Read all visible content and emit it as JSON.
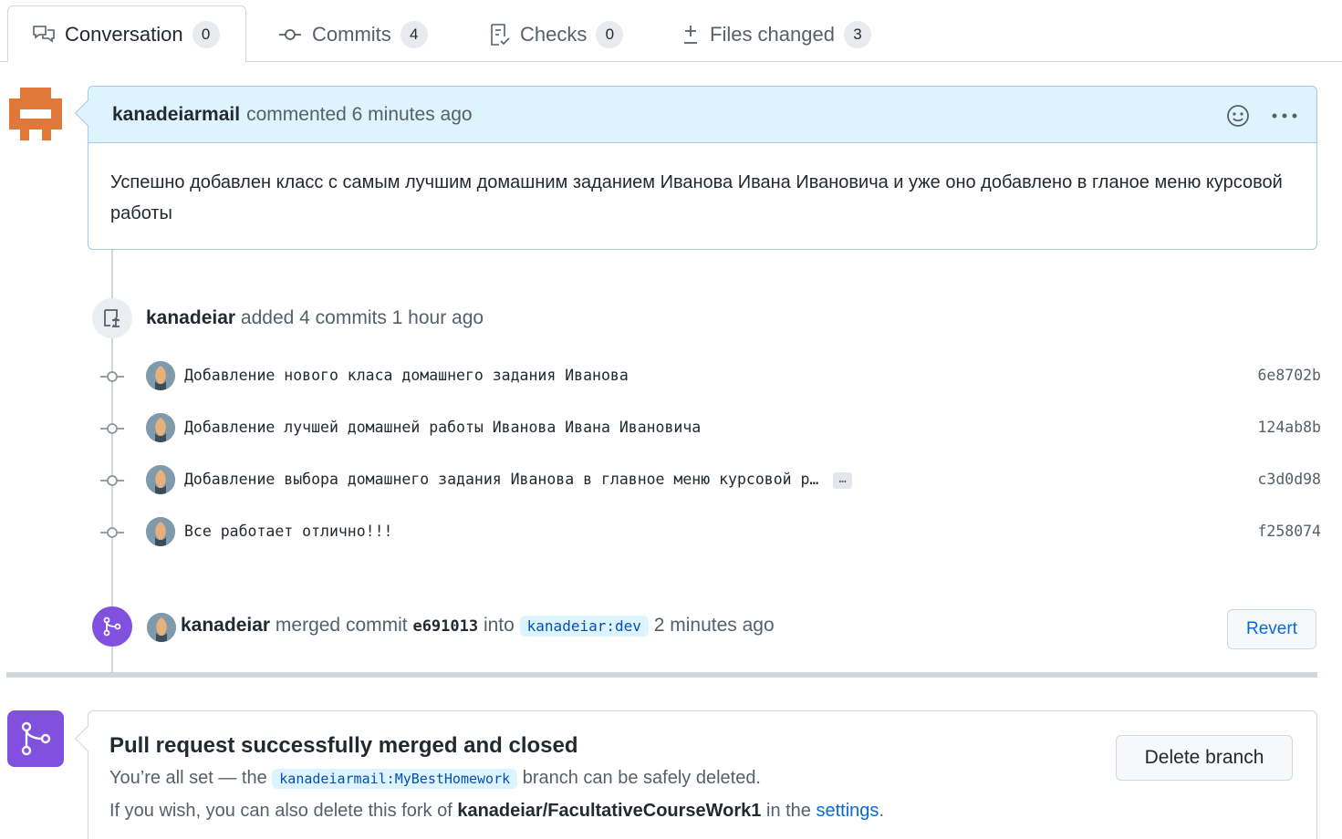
{
  "tabs": [
    {
      "label": "Conversation",
      "count": "0",
      "icon": "comment-discussion-icon"
    },
    {
      "label": "Commits",
      "count": "4",
      "icon": "git-commit-icon"
    },
    {
      "label": "Checks",
      "count": "0",
      "icon": "checklist-icon"
    },
    {
      "label": "Files changed",
      "count": "3",
      "icon": "file-diff-icon"
    }
  ],
  "comment": {
    "author": "kanadeiarmail",
    "meta": "commented 6 minutes ago",
    "body": "Успешно добавлен класс с самым лучшим домашним заданием Иванова Ивана Ивановича и уже оно добавлено в гланое меню курсовой работы"
  },
  "commits_event": {
    "author": "kanadeiar",
    "text": "added 4 commits 1 hour ago"
  },
  "commits": [
    {
      "message": "Добавление нового класа домашнего задания Иванова",
      "sha": "6e8702b"
    },
    {
      "message": "Добавление лучшей домашней работы Иванова Ивана Ивановича",
      "sha": "124ab8b"
    },
    {
      "message": "Добавление выбора домашнего задания Иванова в главное меню курсовой р…",
      "sha": "c3d0d98",
      "more": "…"
    },
    {
      "message": "Все работает отлично!!!",
      "sha": "f258074"
    }
  ],
  "merge_event": {
    "author": "kanadeiar",
    "text_merged": "merged commit",
    "commit": "e691013",
    "text_into": "into",
    "branch": "kanadeiar:dev",
    "time": "2 minutes ago",
    "revert_label": "Revert"
  },
  "merged_box": {
    "title": "Pull request successfully merged and closed",
    "line1_pre": "You’re all set — the",
    "branch": "kanadeiarmail:MyBestHomework",
    "line1_post": "branch can be safely deleted.",
    "line2_pre": "If you wish, you can also delete this fork of",
    "repo": "kanadeiar/FacultativeCourseWork1",
    "line2_mid": "in the",
    "settings_link": "settings",
    "line2_end": ".",
    "delete_label": "Delete branch"
  },
  "colors": {
    "accent_blue": "#0969da",
    "merged_purple": "#8250df",
    "comment_header_bg": "#ddf4ff",
    "avatar_orange": "#e0783a"
  }
}
